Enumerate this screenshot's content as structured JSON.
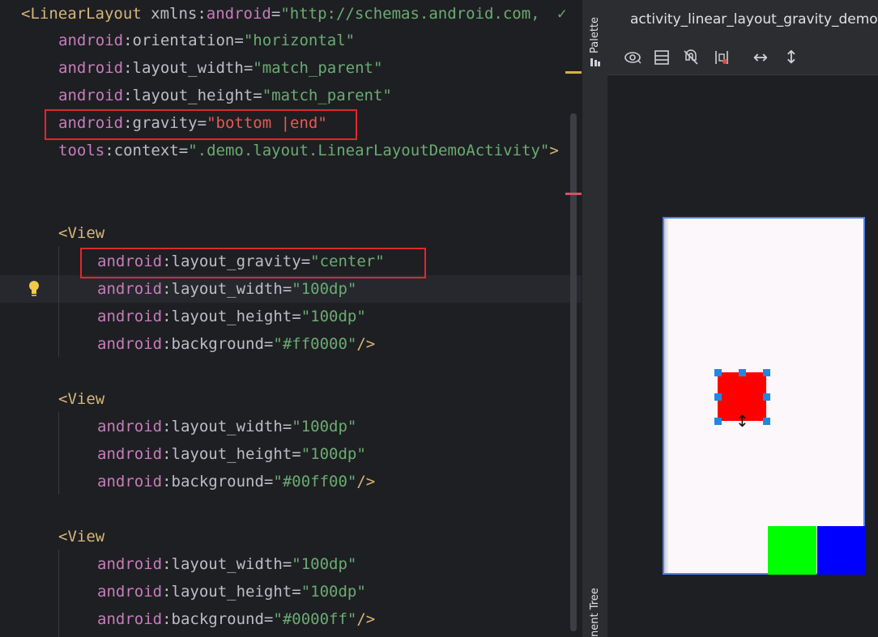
{
  "editor": {
    "lines": [
      {
        "tag_open": "<LinearLayout",
        "extra": " xmlns:",
        "ns": "android",
        "eq": "=",
        "val": "\"http://schemas.android.com,"
      },
      {
        "ns": "android",
        "sep": ":",
        "name": "orientation",
        "eq": "=",
        "val": "\"horizontal\""
      },
      {
        "ns": "android",
        "sep": ":",
        "name": "layout_width",
        "eq": "=",
        "val": "\"match_parent\""
      },
      {
        "ns": "android",
        "sep": ":",
        "name": "layout_height",
        "eq": "=",
        "val": "\"match_parent\""
      },
      {
        "ns": "android",
        "sep": ":",
        "name": "gravity",
        "eq": "=",
        "val": "\"bottom |end\""
      },
      {
        "ns": "tools",
        "sep": ":",
        "name": "context",
        "eq": "=",
        "val": "\".demo.layout.LinearLayoutDemoActivity\"",
        "close": ">"
      },
      {
        "tag_open": "<View"
      },
      {
        "ns": "android",
        "sep": ":",
        "name": "layout_gravity",
        "eq": "=",
        "val": "\"center\""
      },
      {
        "ns": "android",
        "sep": ":",
        "name": "layout_width",
        "eq": "=",
        "val": "\"100dp\""
      },
      {
        "ns": "android",
        "sep": ":",
        "name": "layout_height",
        "eq": "=",
        "val": "\"100dp\""
      },
      {
        "ns": "android",
        "sep": ":",
        "name": "background",
        "eq": "=",
        "val": "\"#ff0000\"",
        "close": "/>"
      },
      {
        "tag_open": "<View"
      },
      {
        "ns": "android",
        "sep": ":",
        "name": "layout_width",
        "eq": "=",
        "val": "\"100dp\""
      },
      {
        "ns": "android",
        "sep": ":",
        "name": "layout_height",
        "eq": "=",
        "val": "\"100dp\""
      },
      {
        "ns": "android",
        "sep": ":",
        "name": "background",
        "eq": "=",
        "val": "\"#00ff00\"",
        "close": "/>"
      },
      {
        "tag_open": "<View"
      },
      {
        "ns": "android",
        "sep": ":",
        "name": "layout_width",
        "eq": "=",
        "val": "\"100dp\""
      },
      {
        "ns": "android",
        "sep": ":",
        "name": "layout_height",
        "eq": "=",
        "val": "\"100dp\""
      },
      {
        "ns": "android",
        "sep": ":",
        "name": "background",
        "eq": "=",
        "val": "\"#0000ff\"",
        "close": "/>"
      }
    ],
    "checkmark": "✓"
  },
  "side_panel": {
    "palette_label": "Palette",
    "component_tree_label": "nent Tree"
  },
  "design": {
    "tab_title": "activity_linear_layout_gravity_demo.xml",
    "toolbar_icons": [
      "eye-icon",
      "blueprint-icon",
      "no-magnet-icon",
      "constraint-icon",
      "horizontal-arrows-icon",
      "vertical-arrows-icon"
    ],
    "horizontal_arrows": "↔",
    "vertical_arrows": "↕",
    "views": [
      {
        "name": "red-view",
        "color": "#ff0000"
      },
      {
        "name": "green-view",
        "color": "#00ff00"
      },
      {
        "name": "blue-view",
        "color": "#0000ff"
      }
    ]
  },
  "colors": {
    "red_box": "#e4262c",
    "selection": "#1e88e5"
  }
}
